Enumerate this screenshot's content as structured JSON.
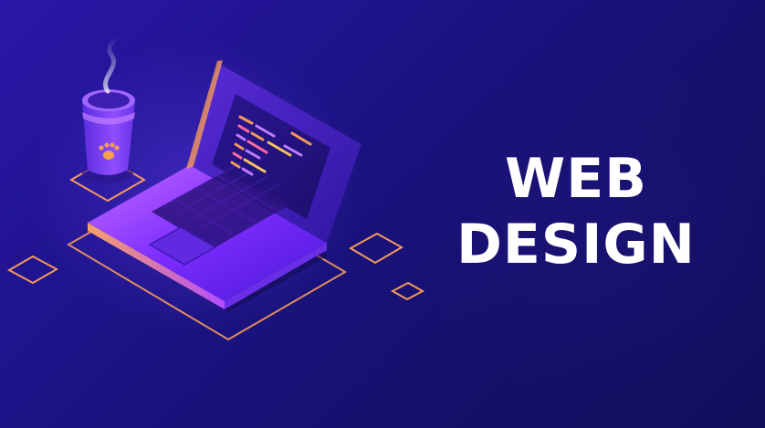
{
  "headline": {
    "line1": "WEB",
    "line2": "DESIGN"
  },
  "colors": {
    "background": "#171269",
    "accent_orange": "#f59a5a",
    "accent_purple": "#8c3dff",
    "text": "#ffffff"
  },
  "icons": [
    "coffee-cup-icon",
    "steam-icon",
    "paw-icon",
    "laptop-icon",
    "code-screen-icon"
  ]
}
